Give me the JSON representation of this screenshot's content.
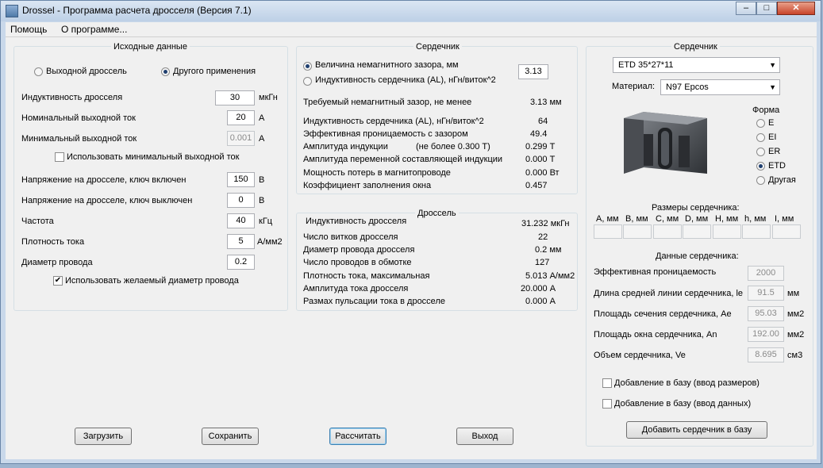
{
  "window": {
    "title": "Drossel - Программа расчета дросселя (Версия 7.1)"
  },
  "menu": {
    "items": [
      "Помощь",
      "О программе..."
    ]
  },
  "input_group": {
    "title": "Исходные данные",
    "radio_output": "Выходной дроссель",
    "radio_other": "Другого применения",
    "inductance_label": "Индуктивность  дросселя",
    "inductance_value": "30",
    "inductance_unit": "мкГн",
    "nominal_label": "Номинальный выходной ток",
    "nominal_value": "20",
    "nominal_unit": "А",
    "min_label": "Минимальный выходной ток",
    "min_value": "0.001",
    "min_unit": "А",
    "use_min_label": "Использовать минимальный выходной ток",
    "von_label": "Напряжение на дросселе, ключ включен",
    "von_value": "150",
    "von_unit": "В",
    "voff_label": "Напряжение на дросселе, ключ выключен",
    "voff_value": "0",
    "voff_unit": "В",
    "freq_label": "Частота",
    "freq_value": "40",
    "freq_unit": "кГц",
    "density_label": "Плотность тока",
    "density_value": "5",
    "density_unit": "А/мм2",
    "wire_label": "Диаметр провода",
    "wire_value": "0.2",
    "use_wire_label": "Использовать желаемый диаметр провода"
  },
  "core_calc": {
    "title": "Сердечник",
    "radio_gap": "Величина немагнитного зазора, мм",
    "gap_value": "3.13",
    "radio_al": "Индуктивность сердечника (AL), нГн/виток^2",
    "rows": [
      {
        "label": "Требуемый немагнитный зазор, не менее",
        "value": "3.13 мм"
      },
      {
        "label": "Индуктивность сердечника (AL), нГн/виток^2",
        "value": "64"
      },
      {
        "label": "Эффективная проницаемость с зазором",
        "value": "49.4"
      },
      {
        "label": "Амплитуда индукции",
        "note": "(не более 0.300 Т)",
        "value": "0.299 Т"
      },
      {
        "label": "Амплитуда переменной составляющей индукции",
        "value": "0.000 Т"
      },
      {
        "label": "Мощность потерь в магнитопроводе",
        "value": "0.000 Вт"
      },
      {
        "label": "Коэффициент заполнения окна",
        "value": "0.457"
      }
    ]
  },
  "choke": {
    "title": "Дроссель",
    "rows": [
      {
        "label": "Индуктивность дросселя",
        "value": "31.232 мкГн"
      },
      {
        "label": "Число витков дросселя",
        "value": "22"
      },
      {
        "label": "Диаметр провода дросселя",
        "value": "0.2 мм"
      },
      {
        "label": "Число проводов в обмотке",
        "value": "127"
      },
      {
        "label": "Плотность тока, максимальная",
        "value": "5.013 А/мм2"
      },
      {
        "label": "Амплитуда тока дросселя",
        "value": "20.000 А"
      },
      {
        "label": "Размах пульсации тока в дросселе",
        "value": "0.000 А"
      }
    ]
  },
  "core_select": {
    "title": "Сердечник",
    "core_value": "ETD 35*27*11",
    "material_label": "Материал:",
    "material_value": "N97 Epcos",
    "shape_label": "Форма",
    "shapes": [
      "E",
      "EI",
      "ER",
      "ETD",
      "Другая"
    ],
    "selected_shape": "ETD",
    "dims_title": "Размеры сердечника:",
    "dims": [
      "A, мм",
      "B, мм",
      "C, мм",
      "D, мм",
      "H, мм",
      "h, мм",
      "I, мм"
    ],
    "data_title": "Данные сердечника:",
    "perm_label": "Эффективная проницаемость",
    "perm_value": "2000",
    "le_label": "Длина средней линии сердечника, le",
    "le_value": "91.5",
    "le_unit": "мм",
    "ae_label": "Площадь сечения сердечника, Ae",
    "ae_value": "95.03",
    "ae_unit": "мм2",
    "an_label": "Площадь окна сердечника, An",
    "an_value": "192.00",
    "an_unit": "мм2",
    "ve_label": "Объем сердечника, Ve",
    "ve_value": "8.695",
    "ve_unit": "см3",
    "add_dims_label": "Добавление в базу (ввод размеров)",
    "add_data_label": "Добавление в базу (ввод данных)",
    "add_button": "Добавить сердечник в базу"
  },
  "buttons": {
    "load": "Загрузить",
    "save": "Сохранить",
    "calc": "Рассчитать",
    "exit": "Выход"
  }
}
